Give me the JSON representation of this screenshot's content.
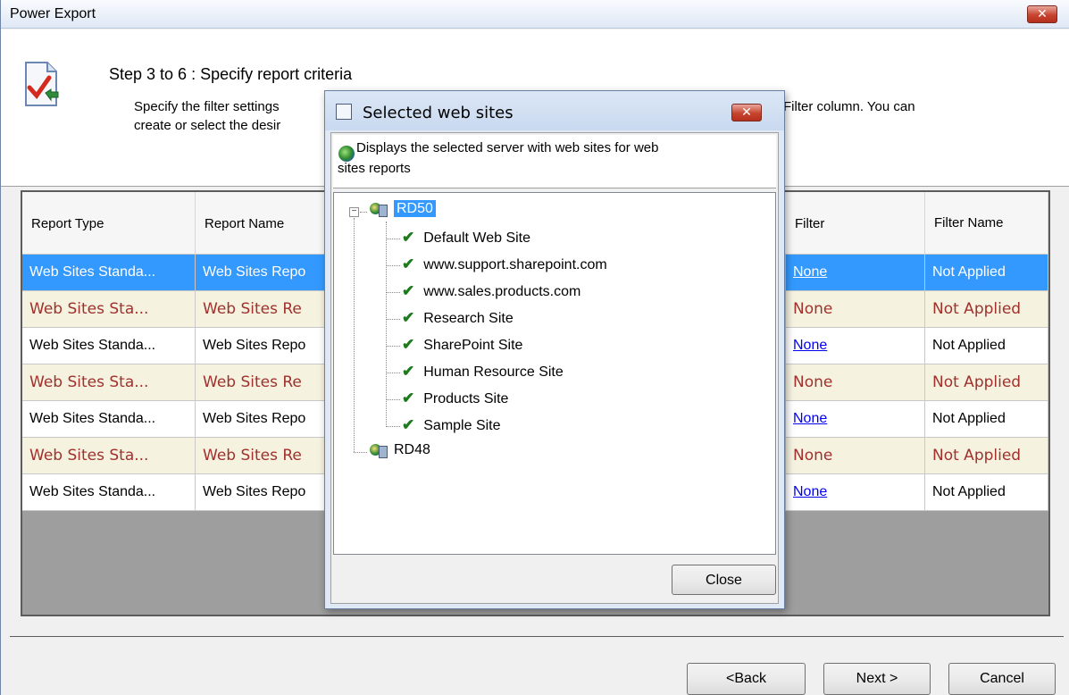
{
  "window": {
    "title": "Power Export",
    "close_label": "✕"
  },
  "header": {
    "step_title": "Step 3 to 6 : Specify report criteria",
    "desc_line1_start": "Specify the filter settings",
    "desc_line1_end": "Filter column. You can",
    "desc_line2": "create or select the desir"
  },
  "grid": {
    "columns": [
      "Report Type",
      "Report Name",
      "Filter",
      "Filter Name"
    ],
    "rows": [
      {
        "type": "Web Sites Standa...",
        "name": "Web Sites Repo",
        "filter": "None",
        "filter_name": "Not Applied",
        "style": "sel"
      },
      {
        "type": "Web Sites Sta...",
        "name": "Web Sites Re",
        "filter": "None",
        "filter_name": "Not Applied",
        "style": "alt"
      },
      {
        "type": "Web Sites Standa...",
        "name": "Web Sites Repo",
        "filter": "None",
        "filter_name": "Not Applied",
        "style": "white"
      },
      {
        "type": "Web Sites Sta...",
        "name": "Web Sites Re",
        "filter": "None",
        "filter_name": "Not Applied",
        "style": "alt"
      },
      {
        "type": "Web Sites Standa...",
        "name": "Web Sites Repo",
        "filter": "None",
        "filter_name": "Not Applied",
        "style": "white"
      },
      {
        "type": "Web Sites Sta...",
        "name": "Web Sites Re",
        "filter": "None",
        "filter_name": "Not Applied",
        "style": "alt"
      },
      {
        "type": "Web Sites Standa...",
        "name": "Web Sites Repo",
        "filter": "None",
        "filter_name": "Not Applied",
        "style": "white"
      }
    ]
  },
  "footer": {
    "back_label": "<Back",
    "next_label": "Next >",
    "cancel_label": "Cancel"
  },
  "dialog": {
    "title": "Selected web sites",
    "close_label": "✕",
    "desc_line1": "Displays the selected server with web sites for web",
    "desc_line2": "sites reports",
    "tree": {
      "servers": [
        {
          "name": "RD50",
          "sites": [
            "Default Web Site",
            "www.support.sharepoint.com",
            "www.sales.products.com",
            "Research Site",
            "SharePoint Site",
            "Human Resource Site",
            "Products Site",
            "Sample Site"
          ]
        },
        {
          "name": "RD48",
          "sites": []
        }
      ]
    },
    "close_button_label": "Close"
  }
}
